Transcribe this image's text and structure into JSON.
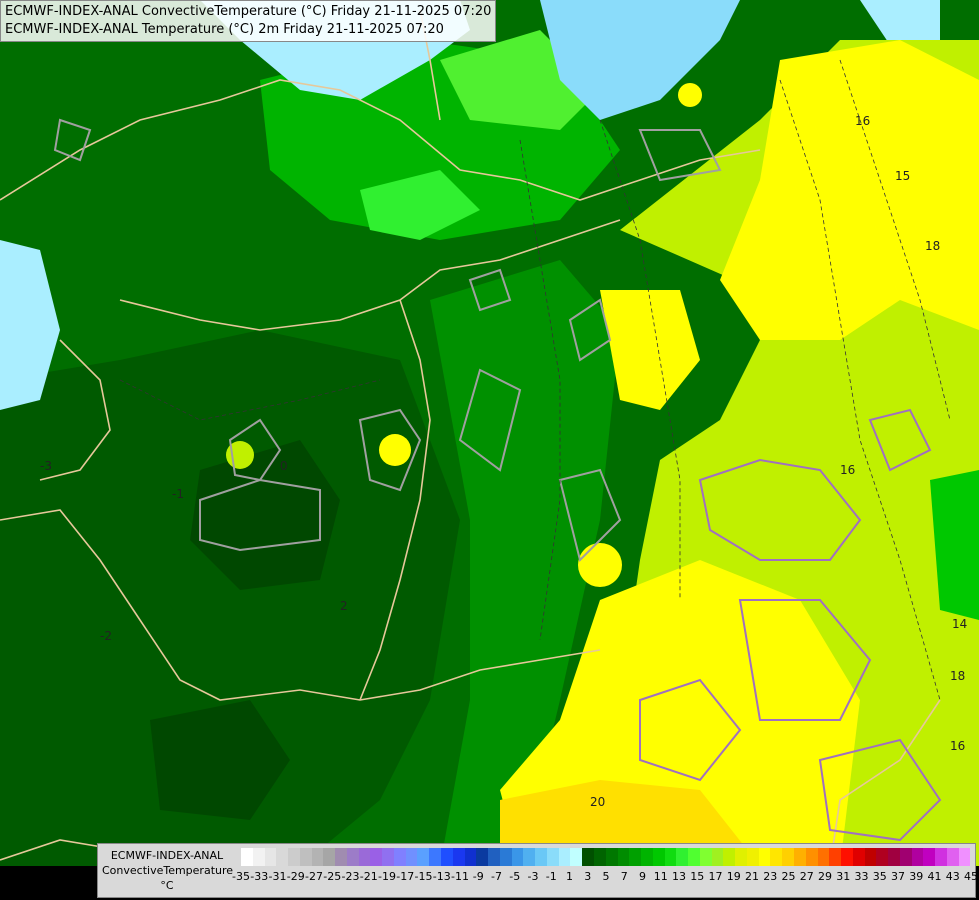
{
  "title": {
    "line1": "ECMWF-INDEX-ANAL ConvectiveTemperature (°C) Friday 21-11-2025 07:20",
    "line2": "ECMWF-INDEX-ANAL Temperature (°C) 2m Friday 21-11-2025 07:20"
  },
  "legend": {
    "label_line1": "ECMWF-INDEX-ANAL",
    "label_line2": "ConvectiveTemperature",
    "unit": "°C",
    "ticks": [
      "-35",
      "-33",
      "-31",
      "-29",
      "-27",
      "-25",
      "-23",
      "-21",
      "-19",
      "-17",
      "-15",
      "-13",
      "-11",
      "-9",
      "-7",
      "-5",
      "-3",
      "-1",
      "1",
      "3",
      "5",
      "7",
      "9",
      "11",
      "13",
      "15",
      "17",
      "19",
      "21",
      "23",
      "25",
      "27",
      "29",
      "31",
      "33",
      "35",
      "37",
      "39",
      "41",
      "43",
      "45"
    ],
    "colors": [
      "#ffffff",
      "#f2f2f2",
      "#e6e6e6",
      "#d9d9d9",
      "#cccccc",
      "#bfbfbf",
      "#b3b3b3",
      "#a6a6a6",
      "#a08cb0",
      "#9c7cc8",
      "#9a6ad8",
      "#9a60e6",
      "#9070f0",
      "#8080ff",
      "#7090ff",
      "#5aa0ff",
      "#3c78ff",
      "#1f4fff",
      "#1a38f0",
      "#1030d0",
      "#0a3aa0",
      "#2060c0",
      "#2a7ad6",
      "#3a96e8",
      "#50b0f0",
      "#6ac8f6",
      "#8adcfa",
      "#aaeeff",
      "#c0ffff",
      "#005000",
      "#006400",
      "#007800",
      "#008c00",
      "#00a000",
      "#00b400",
      "#00c800",
      "#10dc10",
      "#30f030",
      "#50ff30",
      "#80ff30",
      "#a0f020",
      "#c0f000",
      "#e0f000",
      "#f0f000",
      "#ffff00",
      "#ffe600",
      "#ffd000",
      "#ffb000",
      "#ff9000",
      "#ff7000",
      "#ff4000",
      "#ff1000",
      "#e00000",
      "#c00000",
      "#b00020",
      "#a00040",
      "#a00070",
      "#b000a0",
      "#c000c0",
      "#d030e0",
      "#e060f0",
      "#f090ff"
    ]
  },
  "map": {
    "palette": {
      "dark_green": "#005a00",
      "mid_green": "#007800",
      "green": "#009600",
      "bright_green": "#00c800",
      "lime": "#50f030",
      "yellow_green": "#c0f000",
      "yellow": "#ffff00",
      "gold": "#ffe000",
      "light_blue": "#aaeeff",
      "border": "#e6c89a",
      "contour_gray": "#a0a0a0",
      "contour_purple": "#a070c0"
    },
    "contour_labels": [
      "16",
      "15",
      "18",
      "16",
      "14",
      "18",
      "16",
      "-3",
      "-2",
      "-1",
      "0",
      "2",
      "20"
    ]
  }
}
